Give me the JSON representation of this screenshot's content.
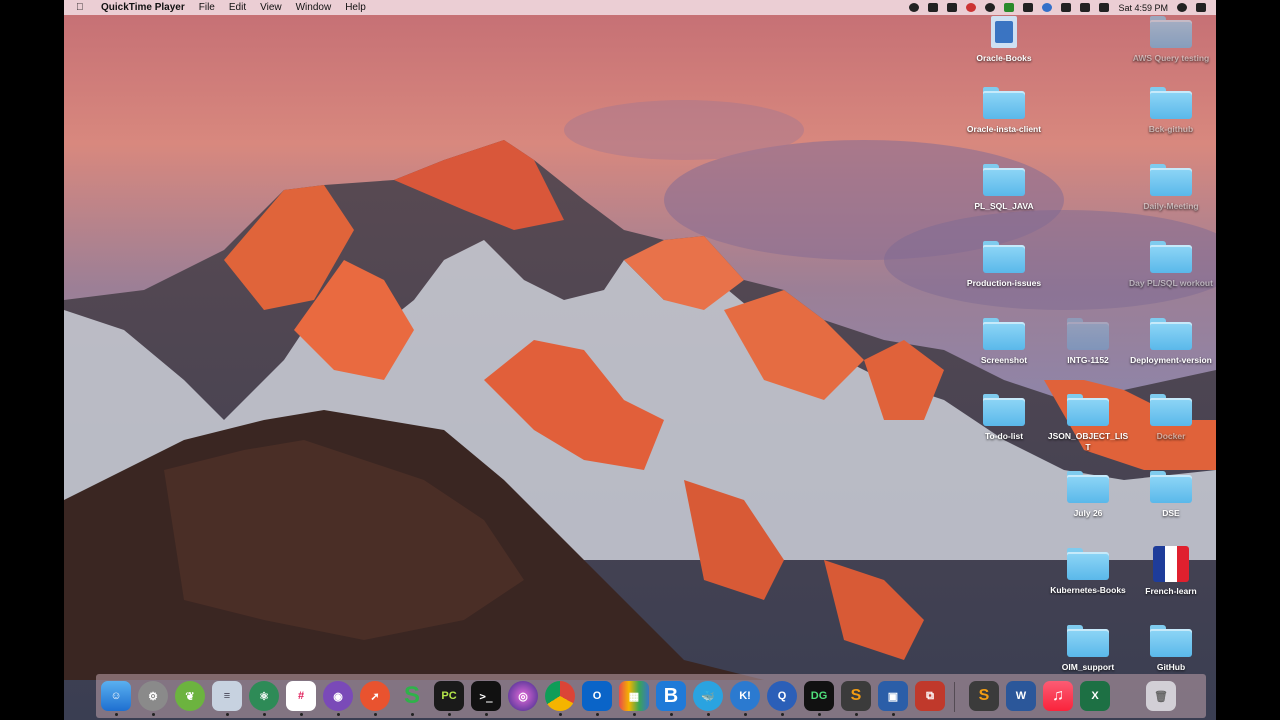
{
  "menubar": {
    "app_name": "QuickTime Player",
    "menus": [
      "File",
      "Edit",
      "View",
      "Window",
      "Help"
    ],
    "clock": "Sat 4:59 PM"
  },
  "desktop": {
    "icons": {
      "oracle_books": "Oracle-Books",
      "aws_query": "AWS Query testing",
      "oracle_insta": "Oracle-insta-client",
      "bck_github": "Bck-github",
      "pl_sql_java": "PL_SQL_JAVA",
      "daily_meeting": "Daily-Meeting",
      "production_issues": "Production-issues",
      "day_plsql": "Day PL/SQL workout",
      "screenshot": "Screenshot",
      "intg": "INTG-1152",
      "deployment": "Deployment-version",
      "todo": "To-do-list",
      "json_object": "JSON_OBJECT_LIST",
      "docker": "Docker",
      "july26": "July 26",
      "dse": "DSE",
      "kubernetes": "Kubernetes-Books",
      "french": "French-learn",
      "oim": "OIM_support",
      "github": "GitHub"
    }
  },
  "dock": {
    "pycharm_label": "PC",
    "datagrip_label": "DG",
    "box_label": "B",
    "k_label": "K!",
    "sublime_label": "S",
    "word_label": "W",
    "excel_label": "X"
  }
}
